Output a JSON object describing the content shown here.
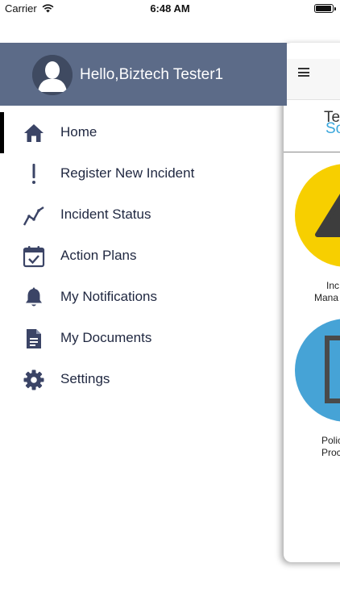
{
  "status_bar": {
    "carrier": "Carrier",
    "time": "6:48 AM"
  },
  "drawer": {
    "greeting": "Hello,Biztech Tester1",
    "items": [
      {
        "label": "Home",
        "icon": "home-icon",
        "active": true
      },
      {
        "label": "Register New Incident",
        "icon": "exclamation-icon"
      },
      {
        "label": "Incident Status",
        "icon": "trend-icon"
      },
      {
        "label": "Action Plans",
        "icon": "calendar-check-icon"
      },
      {
        "label": "My Notifications",
        "icon": "bell-icon"
      },
      {
        "label": "My Documents",
        "icon": "document-icon"
      },
      {
        "label": "Settings",
        "icon": "gear-icon"
      }
    ]
  },
  "background_app": {
    "logo_top": "Te",
    "logo_bottom": "So",
    "tile_1": {
      "line1": "Inc",
      "line2": "Mana"
    },
    "tile_2": {
      "line1": "Polic",
      "line2": "Proc"
    }
  },
  "colors": {
    "header_bg": "#5c6b88",
    "icon": "#3b4466",
    "accent_yellow": "#f7cf00",
    "accent_blue": "#46a3d6"
  }
}
